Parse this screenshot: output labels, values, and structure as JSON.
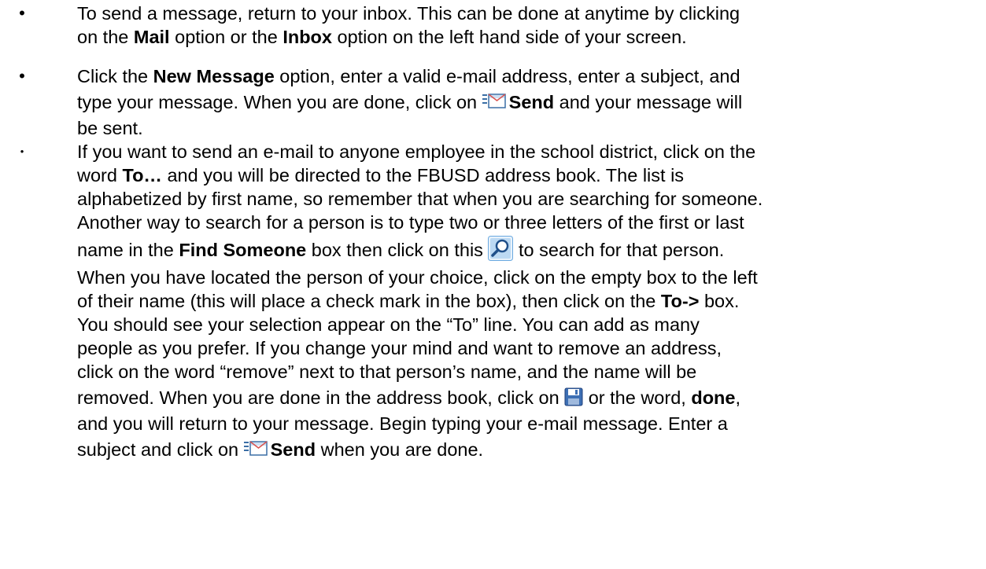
{
  "bullets": [
    {
      "lines": [
        "To send a message, return to your inbox.  This can be done at anytime by clicking",
        "on the ",
        "Mail",
        " option or the ",
        "Inbox",
        " option on the left hand side of your screen."
      ]
    },
    {
      "t1": "Click the ",
      "b1": "New Message",
      "t2": " option, enter a valid e-mail address, enter a subject, and",
      "t3": "type your message.  When you are done, click on ",
      "b2": "Send",
      "t4": " and your message will",
      "t5": "be sent."
    },
    {
      "l1": "If you want to send an e-mail to anyone employee in the school district, click on the",
      "l2a": "word ",
      "l2b": "To…",
      "l2c": " and you will be directed to the FBUSD address book.  The list is",
      "l3": "alphabetized by first name, so remember that when you are searching for someone.",
      "l4": "Another way to search for a person is to type two or three letters of the first or last",
      "l5a": "name in the ",
      "l5b": "Find Someone",
      "l5c": " box then click on this ",
      "l5d": " to search for that person.",
      "l6": "When you have located the person of your choice, click on the empty box to the left",
      "l7a": "of their name (this will place a check mark in the box), then click on the ",
      "l7b": "To->",
      "l7c": " box.",
      "l8": "You should see your selection appear on the “To” line.  You can add as many",
      "l9": "people as you prefer.  If you change your mind and want to remove an address,",
      "l10": "click on the word “remove” next to that person’s name, and the name will be",
      "l11a": "removed.  When you are done in the address book, click on ",
      "l11b": " or the word, ",
      "l11c": "done",
      "l11d": ",",
      "l12": "and you will return to your message.   Begin typing your e-mail message.  Enter a",
      "l13a": "subject and click on ",
      "l13b": "Send",
      "l13c": " when you are done."
    }
  ],
  "bullet_symbol": "•",
  "icons": {
    "send": "send-envelope-icon",
    "search": "magnifier-icon",
    "save": "floppy-save-icon"
  },
  "colors": {
    "send_icon_border": "#3a6ea5",
    "send_icon_flap": "#d9534f",
    "search_icon_bg": "#6aa9e0",
    "save_icon_body": "#3d6fb4"
  }
}
